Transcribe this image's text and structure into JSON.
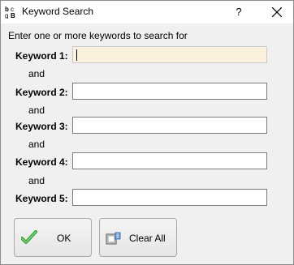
{
  "window": {
    "title": "Keyword Search",
    "help_glyph": "?"
  },
  "intro": "Enter one or more keywords to search for",
  "keywords": [
    {
      "label": "Keyword 1:",
      "value": ""
    },
    {
      "label": "Keyword 2:",
      "value": ""
    },
    {
      "label": "Keyword 3:",
      "value": ""
    },
    {
      "label": "Keyword 4:",
      "value": ""
    },
    {
      "label": "Keyword 5:",
      "value": ""
    }
  ],
  "connector": "and",
  "buttons": {
    "ok": "OK",
    "clear_all": "Clear All"
  },
  "icons": {
    "app": "keyword-search-app-icon",
    "ok": "checkmark-icon",
    "clear": "clear-icon",
    "close": "close-icon"
  },
  "colors": {
    "active_field": "#fcf1dc",
    "check_green": "#3aa53a"
  }
}
